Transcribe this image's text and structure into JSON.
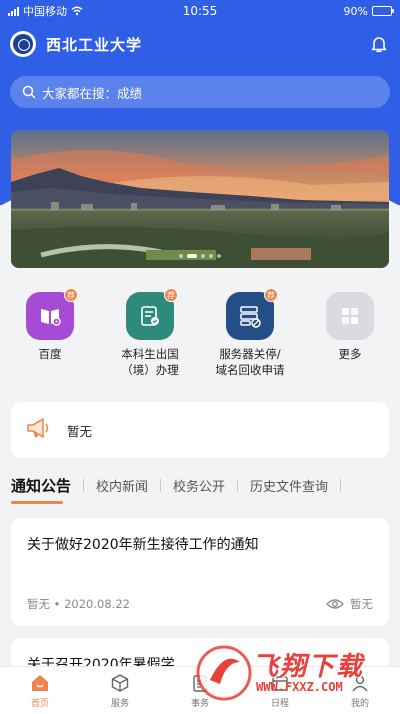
{
  "status_bar": {
    "carrier": "中国移动",
    "time": "10:55",
    "battery": "90%",
    "battery_level": 0.9
  },
  "header": {
    "title": "西北工业大学"
  },
  "search": {
    "placeholder": "大家都在搜：成绩"
  },
  "banner": {
    "slide_count": 5,
    "active_index": 1
  },
  "services": [
    {
      "label": "百度",
      "badge": "荐",
      "icon": "book-gear-icon",
      "color": "#a64bd6"
    },
    {
      "label": "本科生出国\n（境）办理",
      "badge": "荐",
      "icon": "document-stamp-icon",
      "color": "#2e8b7b"
    },
    {
      "label": "服务器关停/\n域名回收申请",
      "badge": "荐",
      "icon": "server-block-icon",
      "color": "#244f86"
    },
    {
      "label": "更多",
      "badge": "",
      "icon": "grid-icon",
      "color": "#d9dbe1"
    }
  ],
  "notice": {
    "text": "暂无"
  },
  "tabs": [
    {
      "label": "通知公告",
      "active": true
    },
    {
      "label": "校内新闻",
      "active": false
    },
    {
      "label": "校务公开",
      "active": false
    },
    {
      "label": "历史文件查询",
      "active": false
    }
  ],
  "articles": [
    {
      "title": "关于做好2020年新生接待工作的通知",
      "source": "暂无",
      "date": "2020.08.22",
      "views": "暂无"
    },
    {
      "title": "关于召开2020年暑假学..."
    }
  ],
  "bottom_nav": [
    {
      "label": "首页",
      "icon": "home-icon",
      "active": true
    },
    {
      "label": "服务",
      "icon": "cube-icon",
      "active": false
    },
    {
      "label": "事务",
      "icon": "clipboard-icon",
      "active": false
    },
    {
      "label": "日程",
      "icon": "calendar-icon",
      "active": false
    },
    {
      "label": "我的",
      "icon": "user-icon",
      "active": false
    }
  ],
  "watermark": {
    "text": "飞翔下载",
    "url": "WWW.FXXZ.COM"
  },
  "colors": {
    "primary": "#2f5fe6",
    "accent": "#f0844a",
    "watermark": "#e8403a"
  }
}
